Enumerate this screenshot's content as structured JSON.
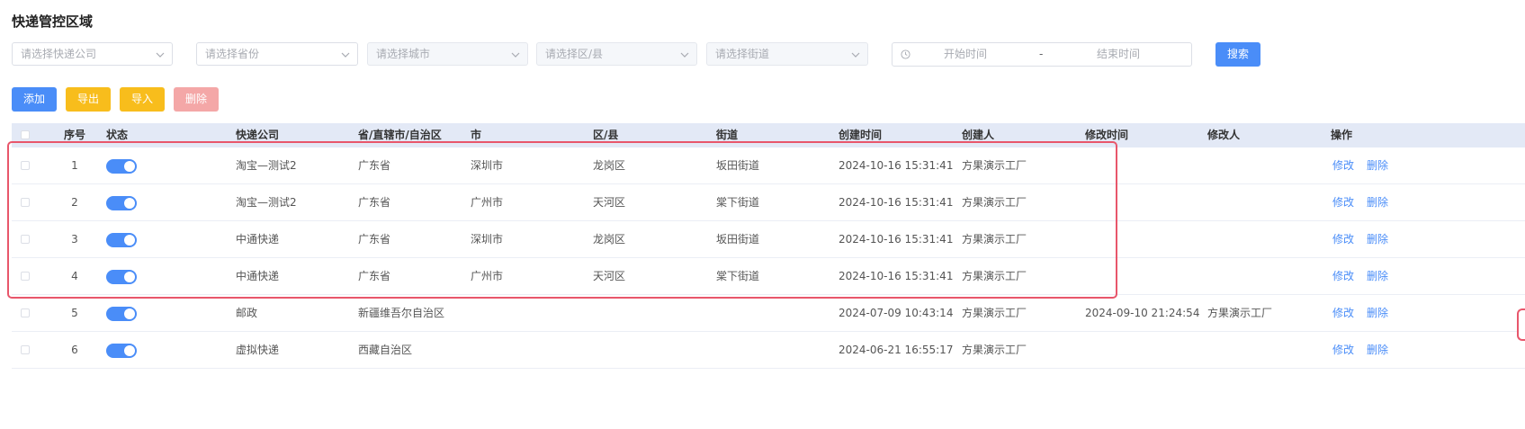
{
  "page": {
    "title": "快递管控区域"
  },
  "filters": {
    "company_placeholder": "请选择快递公司",
    "province_placeholder": "请选择省份",
    "city_placeholder": "请选择城市",
    "district_placeholder": "请选择区/县",
    "street_placeholder": "请选择街道",
    "start_time_placeholder": "开始时间",
    "range_separator": "-",
    "end_time_placeholder": "结束时间",
    "search_label": "搜索"
  },
  "toolbar": {
    "add_label": "添加",
    "export_label": "导出",
    "import_label": "导入",
    "delete_label": "删除"
  },
  "table": {
    "columns": [
      "序号",
      "状态",
      "快递公司",
      "省/直辖市/自治区",
      "市",
      "区/县",
      "街道",
      "创建时间",
      "创建人",
      "修改时间",
      "修改人",
      "操作"
    ],
    "rows": [
      {
        "index": "1",
        "enabled": true,
        "company": "淘宝—测试2",
        "province": "广东省",
        "city": "深圳市",
        "district": "龙岗区",
        "street": "坂田街道",
        "created_at": "2024-10-16 15:31:41",
        "creator": "方果演示工厂",
        "modified_at": "",
        "modifier": "",
        "edit": "修改",
        "delete": "删除"
      },
      {
        "index": "2",
        "enabled": true,
        "company": "淘宝—测试2",
        "province": "广东省",
        "city": "广州市",
        "district": "天河区",
        "street": "棠下街道",
        "created_at": "2024-10-16 15:31:41",
        "creator": "方果演示工厂",
        "modified_at": "",
        "modifier": "",
        "edit": "修改",
        "delete": "删除"
      },
      {
        "index": "3",
        "enabled": true,
        "company": "中通快递",
        "province": "广东省",
        "city": "深圳市",
        "district": "龙岗区",
        "street": "坂田街道",
        "created_at": "2024-10-16 15:31:41",
        "creator": "方果演示工厂",
        "modified_at": "",
        "modifier": "",
        "edit": "修改",
        "delete": "删除"
      },
      {
        "index": "4",
        "enabled": true,
        "company": "中通快递",
        "province": "广东省",
        "city": "广州市",
        "district": "天河区",
        "street": "棠下街道",
        "created_at": "2024-10-16 15:31:41",
        "creator": "方果演示工厂",
        "modified_at": "",
        "modifier": "",
        "edit": "修改",
        "delete": "删除"
      },
      {
        "index": "5",
        "enabled": true,
        "company": "邮政",
        "province": "新疆维吾尔自治区",
        "city": "",
        "district": "",
        "street": "",
        "created_at": "2024-07-09 10:43:14",
        "creator": "方果演示工厂",
        "modified_at": "2024-09-10 21:24:54",
        "modifier": "方果演示工厂",
        "edit": "修改",
        "delete": "删除"
      },
      {
        "index": "6",
        "enabled": true,
        "company": "虚拟快递",
        "province": "西藏自治区",
        "city": "",
        "district": "",
        "street": "",
        "created_at": "2024-06-21 16:55:17",
        "creator": "方果演示工厂",
        "modified_at": "",
        "modifier": "",
        "edit": "修改",
        "delete": "删除"
      }
    ]
  },
  "colors": {
    "primary": "#4a8df8",
    "warning": "#f8bd1c",
    "danger_light": "#f4a7a7",
    "header_bg": "#e3e9f6",
    "highlight": "#e8566b"
  }
}
